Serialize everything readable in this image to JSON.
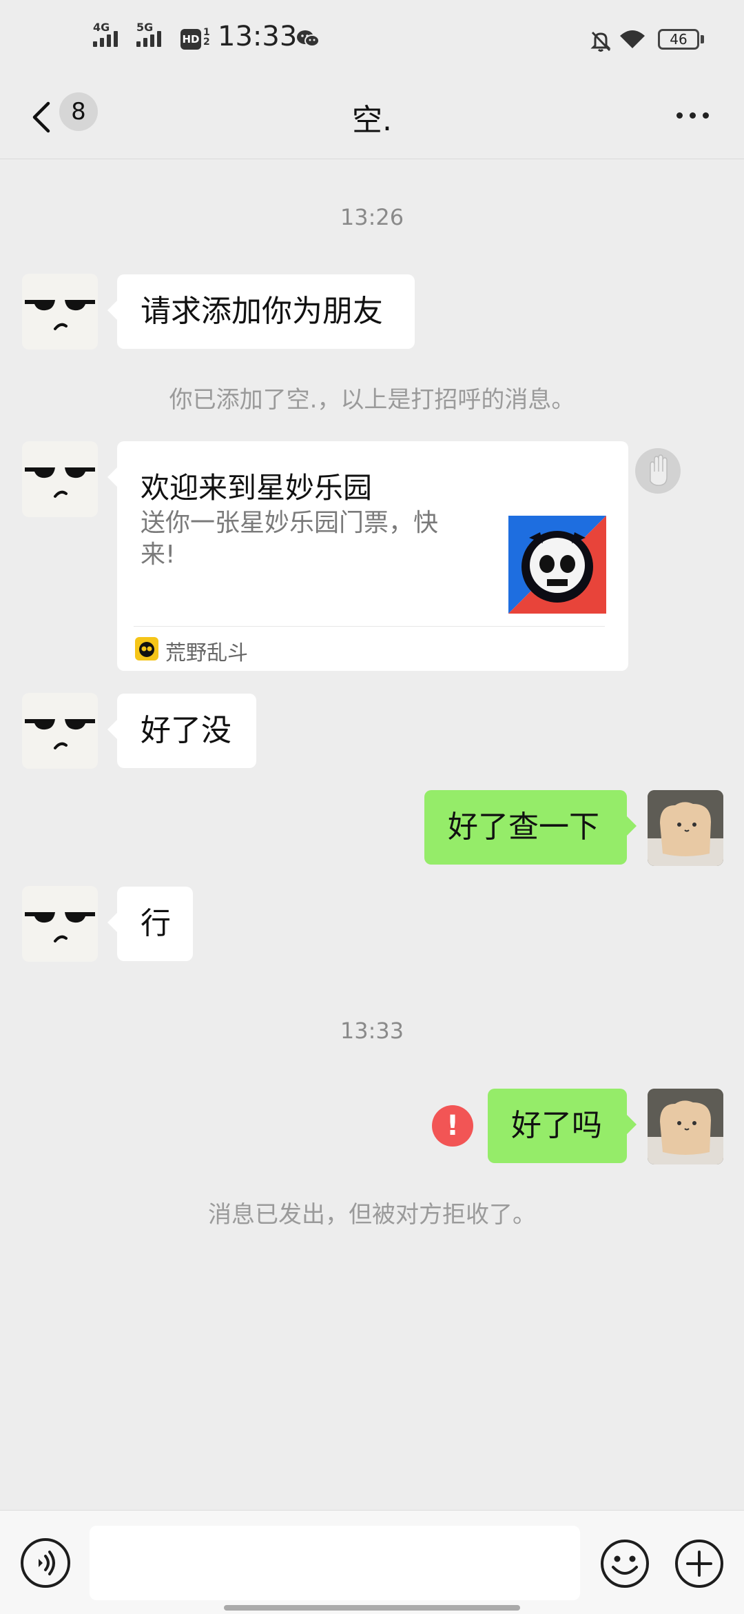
{
  "status_bar": {
    "sim1_label": "4G",
    "sim2_label": "5G",
    "hd_label": "HD",
    "hd_sub": "1 2",
    "time": "13:33",
    "battery": "46"
  },
  "header": {
    "unread_count": "8",
    "title": "空."
  },
  "messages": {
    "time_1": "13:26",
    "friend_request_text": "请求添加你为朋友",
    "added_note": "你已添加了空.，以上是打招呼的消息。",
    "card": {
      "title": "欢迎来到星妙乐园",
      "description": "送你一张星妙乐园门票，快来!",
      "source": "荒野乱斗"
    },
    "msg_haole_mei": "好了没",
    "msg_chayixia": "好了查一下",
    "msg_xing": "行",
    "time_2": "13:33",
    "msg_haole_ma": "好了吗",
    "error_mark": "!",
    "rejected_note": "消息已发出，但被对方拒收了。"
  },
  "input": {
    "value": "",
    "placeholder": ""
  },
  "colors": {
    "background": "#ededed",
    "bubble_in": "#ffffff",
    "bubble_out": "#95ec69",
    "error": "#f25555"
  },
  "icons": [
    "back-chevron-icon",
    "more-icon",
    "pat-hand-icon",
    "error-icon",
    "voice-icon",
    "emoji-icon",
    "plus-icon",
    "wechat-icon",
    "bell-off-icon",
    "wifi-icon"
  ]
}
